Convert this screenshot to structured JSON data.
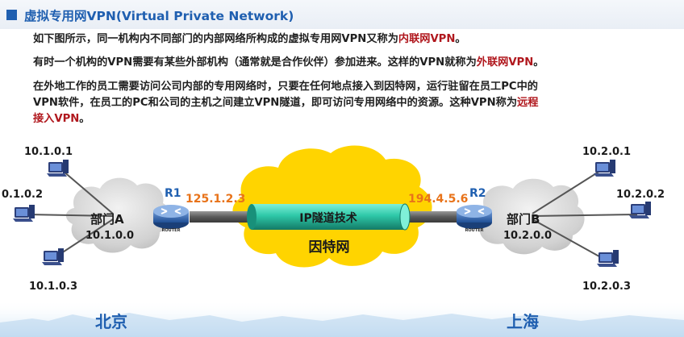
{
  "header": {
    "title": "虚拟专用网VPN(Virtual Private Network)"
  },
  "paragraphs": [
    {
      "text": "如下图所示，同一机构内不同部门的内部网络所构成的虚拟专用网VPN又称为",
      "highlight": "内联网VPN",
      "tail": "。"
    },
    {
      "text": "有时一个机构的VPN需要有某些外部机构（通常就是合作伙伴）参加进来。这样的VPN就称为",
      "highlight": "外联网VPN",
      "tail": "。"
    },
    {
      "line1": "在外地工作的员工需要访问公司内部的专用网络时，只要在任何地点接入到因特网，运行驻留在员工PC中的",
      "line2": "VPN软件，在员工的PC和公司的主机之间建立VPN隧道，即可访问专用网络中的资源。这种VPN称为",
      "highlight1": "远程",
      "highlight2": "接入VPN",
      "tail": "。"
    }
  ],
  "diagram": {
    "left_site": {
      "cloud_name": "部门A",
      "cloud_network": "10.1.0.0",
      "hosts": [
        "10.1.0.1",
        "0.1.0.2",
        "10.1.0.3"
      ],
      "router_label": "R1",
      "router_caption": "ROUTER",
      "public_ip": "125.1.2.3",
      "city": "北京"
    },
    "right_site": {
      "cloud_name": "部门B",
      "cloud_network": "10.2.0.0",
      "hosts": [
        "10.2.0.1",
        "10.2.0.2",
        "10.2.0.3"
      ],
      "router_label": "R2",
      "router_caption": "ROUTER",
      "public_ip": "194.4.5.6",
      "city": "上海"
    },
    "tunnel_label": "IP隧道技术",
    "internet_label": "因特网",
    "colors": {
      "title_blue": "#1f5fb0",
      "highlight_red": "#b0171d",
      "internet_yellow": "#ffd400",
      "tunnel_green": "#2ec8a8",
      "ip_orange": "#e8731a",
      "city_blue": "#1f5fb0"
    }
  }
}
